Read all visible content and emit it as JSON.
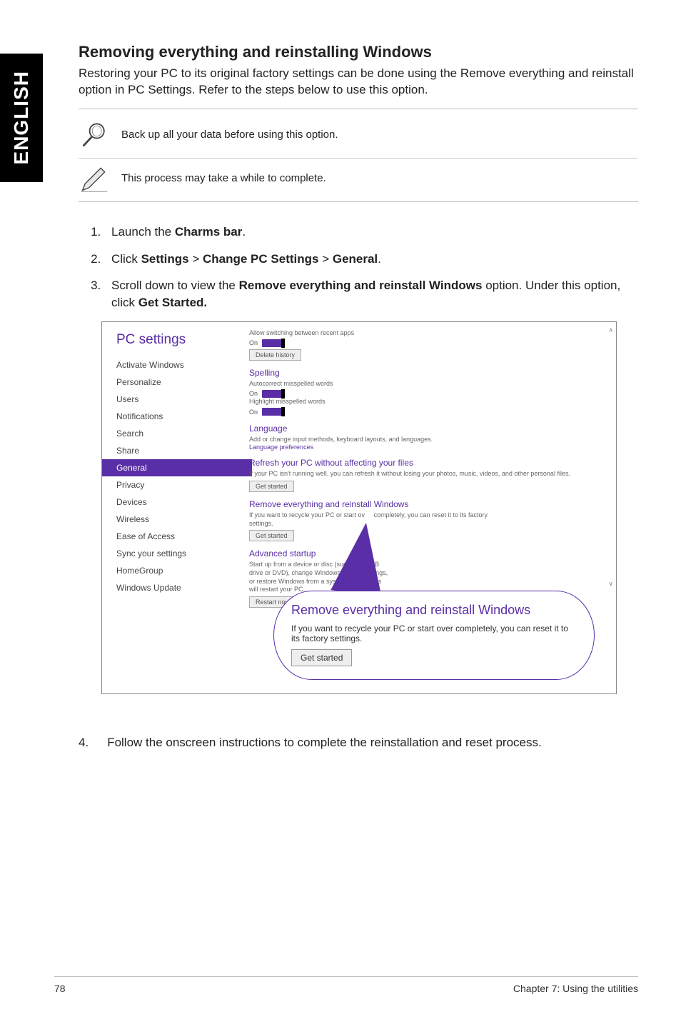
{
  "side_tab": "ENGLISH",
  "section": {
    "title": "Removing everything and reinstalling Windows",
    "intro": "Restoring your PC to its original factory settings can be done using the Remove everything and reinstall option in PC Settings. Refer to the steps below to use this option."
  },
  "notes": [
    {
      "icon": "magnify",
      "text": "Back up all your data before using this option."
    },
    {
      "icon": "pen",
      "text": "This process may take a while to complete."
    }
  ],
  "steps": {
    "s1_pre": "Launch the ",
    "s1_bold": "Charms bar",
    "s1_post": ".",
    "s2_pre": "Click ",
    "s2_b1": "Settings",
    "s2_gt1": " > ",
    "s2_b2": "Change PC Settings",
    "s2_gt2": " > ",
    "s2_b3": "General",
    "s2_post": ".",
    "s3_pre": "Scroll down to view the ",
    "s3_b1": "Remove everything and reinstall Windows",
    "s3_mid": " option. Under this option, click ",
    "s3_b2": "Get Started.",
    "s4_num": "4.",
    "s4_text": "Follow the onscreen instructions to complete the reinstallation and reset process."
  },
  "pc_settings": {
    "title": "PC settings",
    "items": [
      "Activate Windows",
      "Personalize",
      "Users",
      "Notifications",
      "Search",
      "Share",
      "General",
      "Privacy",
      "Devices",
      "Wireless",
      "Ease of Access",
      "Sync your settings",
      "HomeGroup",
      "Windows Update"
    ],
    "selected": "General",
    "main": {
      "switch_apps": "Allow switching between recent apps",
      "on": "On",
      "delete_history": "Delete history",
      "spelling_h": "Spelling",
      "spelling_auto": "Autocorrect misspelled words",
      "spelling_hl": "Highlight misspelled words",
      "lang_h": "Language",
      "lang_desc": "Add or change input methods, keyboard layouts, and languages.",
      "lang_link": "Language preferences",
      "refresh_h": "Refresh your PC without affecting your files",
      "refresh_desc": "If your PC isn't running well, you can refresh it without losing your photos, music, videos, and other personal files.",
      "get_started": "Get started",
      "remove_h": "Remove everything and reinstall Windows",
      "remove_desc_a": "If you want to recycle your PC or start ov",
      "remove_desc_b": "completely, you can reset it to its factory",
      "remove_desc_c": "settings.",
      "advanced_h": "Advanced startup",
      "advanced_desc": "Start up from a device or disc (such as a USB drive or DVD), change Windows startup settings, or restore Windows from a system image. This will restart your PC.",
      "restart_now": "Restart now"
    },
    "callout": {
      "title": "Remove everything and reinstall Windows",
      "desc": "If you want to recycle your PC or start over completely, you can reset it to its factory settings.",
      "btn": "Get started"
    }
  },
  "footer": {
    "page": "78",
    "chapter": "Chapter 7: Using the utilities"
  }
}
